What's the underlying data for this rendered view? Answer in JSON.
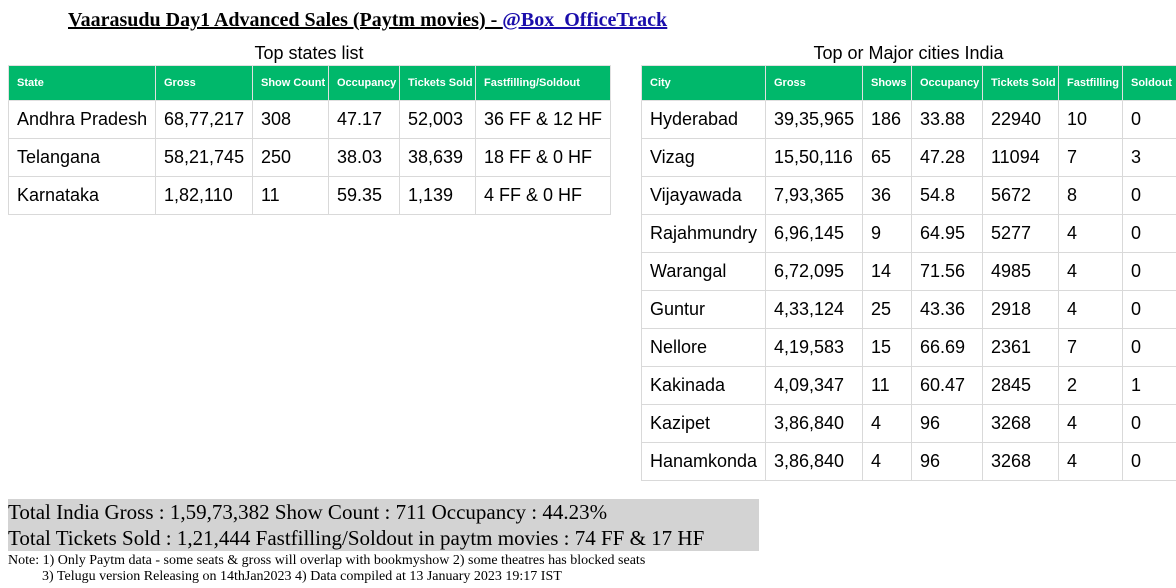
{
  "title": {
    "text": "Vaarasudu Day1 Advanced Sales (Paytm movies) - ",
    "handle": "@Box_OfficeTrack"
  },
  "states": {
    "caption": "Top states list",
    "headers": [
      "State",
      "Gross",
      "Show Count",
      "Occupancy",
      "Tickets Sold",
      "Fastfilling/Soldout"
    ],
    "rows": [
      [
        "Andhra Pradesh",
        "68,77,217",
        "308",
        "47.17",
        "52,003",
        "36 FF & 12 HF"
      ],
      [
        "Telangana",
        "58,21,745",
        "250",
        "38.03",
        "38,639",
        "18 FF & 0 HF"
      ],
      [
        "Karnataka",
        "1,82,110",
        "11",
        "59.35",
        "1,139",
        "4 FF & 0 HF"
      ]
    ]
  },
  "cities": {
    "caption": "Top or Major cities India",
    "headers": [
      "City",
      "Gross",
      "Shows",
      "Occupancy",
      "Tickets Sold",
      "Fastfilling",
      "Soldout"
    ],
    "rows": [
      [
        "Hyderabad",
        "39,35,965",
        "186",
        "33.88",
        "22940",
        "10",
        "0"
      ],
      [
        "Vizag",
        "15,50,116",
        "65",
        "47.28",
        "11094",
        "7",
        "3"
      ],
      [
        "Vijayawada",
        "7,93,365",
        "36",
        "54.8",
        "5672",
        "8",
        "0"
      ],
      [
        "Rajahmundry",
        "6,96,145",
        "9",
        "64.95",
        "5277",
        "4",
        "0"
      ],
      [
        "Warangal",
        "6,72,095",
        "14",
        "71.56",
        "4985",
        "4",
        "0"
      ],
      [
        "Guntur",
        "4,33,124",
        "25",
        "43.36",
        "2918",
        "4",
        "0"
      ],
      [
        "Nellore",
        "4,19,583",
        "15",
        "66.69",
        "2361",
        "7",
        "0"
      ],
      [
        "Kakinada",
        "4,09,347",
        "11",
        "60.47",
        "2845",
        "2",
        "1"
      ],
      [
        "Kazipet",
        "3,86,840",
        "4",
        "96",
        "3268",
        "4",
        "0"
      ],
      [
        "Hanamkonda",
        "3,86,840",
        "4",
        "96",
        "3268",
        "4",
        "0"
      ]
    ]
  },
  "summary": {
    "line1": "Total India Gross : 1,59,73,382    Show Count : 711    Occupancy : 44.23%",
    "line2": "Total Tickets Sold : 1,21,444     Fastfilling/Soldout in paytm movies : 74 FF & 17 HF"
  },
  "note": {
    "line1": "Note: 1) Only Paytm data - some seats & gross will overlap with bookmyshow   2) some theatres has blocked seats",
    "line2": "3) Telugu version Releasing on 14thJan2023 4) Data compiled at 13 January 2023 19:17 IST"
  },
  "colors": {
    "header_bg": "#00b86b",
    "summary_bg": "#d3d3d3",
    "link": "#1a0dab"
  }
}
